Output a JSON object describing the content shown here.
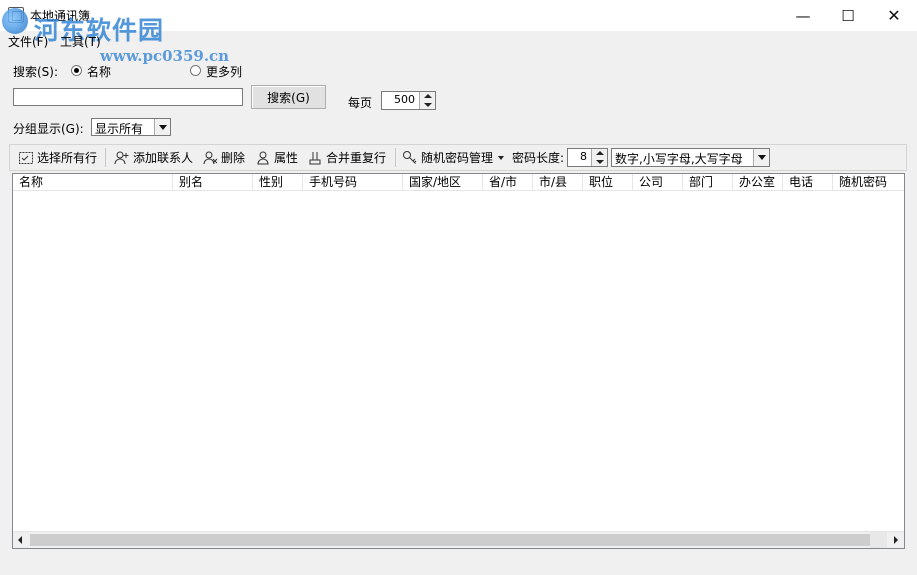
{
  "window": {
    "title": "本地通讯簿",
    "minimize_glyph": "—",
    "maximize_glyph": "☐",
    "close_glyph": "✕"
  },
  "watermark": {
    "name": "河东软件园",
    "url": "www.pc0359.cn"
  },
  "menu": [
    {
      "label": "文件(F)"
    },
    {
      "label": "工具(T)"
    }
  ],
  "search": {
    "label": "搜索(S):",
    "option_name": "名称",
    "option_more": "更多列",
    "selected": "名称",
    "input_value": "",
    "button_label": "搜索(G)",
    "per_page_label": "每页",
    "per_page_value": "500"
  },
  "group": {
    "label": "分组显示(G):",
    "value": "显示所有"
  },
  "toolbar": {
    "select_all": "选择所有行",
    "add_contact": "添加联系人",
    "delete": "删除",
    "properties": "属性",
    "merge_duplicates": "合并重复行",
    "random_password": "随机密码管理",
    "password_length_label": "密码长度:",
    "password_length_value": "8",
    "charset_value": "数字,小写字母,大写字母"
  },
  "table": {
    "columns": [
      "名称",
      "别名",
      "性别",
      "手机号码",
      "国家/地区",
      "省/市",
      "市/县",
      "职位",
      "公司",
      "部门",
      "办公室",
      "电话",
      "随机密码"
    ],
    "rows": []
  },
  "icons": {
    "app": "address-book-icon",
    "select_all": "select-all-icon",
    "add_contact": "add-contact-icon",
    "delete": "delete-contact-icon",
    "properties": "properties-icon",
    "merge": "merge-icon",
    "random_password": "key-icon"
  }
}
